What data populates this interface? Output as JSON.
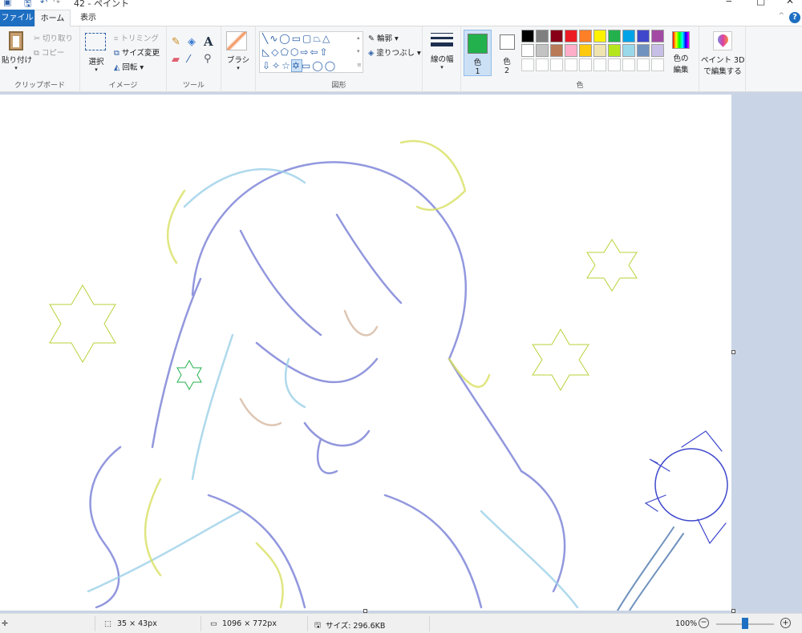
{
  "title": "42 - ペイント",
  "tabs": {
    "file": "ファイル",
    "home": "ホーム",
    "view": "表示"
  },
  "clipboard": {
    "paste": "貼り付け",
    "cut": "切り取り",
    "copy": "コピー",
    "label": "クリップボード"
  },
  "image": {
    "select": "選択",
    "crop": "トリミング",
    "resize": "サイズ変更",
    "rotate": "回転",
    "label": "イメージ"
  },
  "tools": {
    "label": "ツール"
  },
  "brush": {
    "label": "ブラシ"
  },
  "shapes": {
    "label": "図形",
    "outline": "輪郭",
    "fill": "塗りつぶし"
  },
  "size": {
    "label": "線の幅"
  },
  "colors": {
    "color1": "色",
    "color1_num": "1",
    "color2": "色",
    "color2_num": "2",
    "color1_value": "#22b14c",
    "color2_value": "#ffffff",
    "edit_line1": "色の",
    "edit_line2": "編集",
    "label": "色",
    "palette_row1": [
      "#000000",
      "#7f7f7f",
      "#880015",
      "#ed1c24",
      "#ff7f27",
      "#fff200",
      "#22b14c",
      "#00a2e8",
      "#3f48cc",
      "#a349a4"
    ],
    "palette_row2": [
      "#ffffff",
      "#c3c3c3",
      "#b97a57",
      "#ffaec9",
      "#ffc90e",
      "#efe4b0",
      "#b5e61d",
      "#99d9ea",
      "#7092be",
      "#c8bfe7"
    ]
  },
  "paint3d": {
    "line1": "ペイント 3D",
    "line2": "で編集する"
  },
  "status": {
    "selection": "35 × 43px",
    "image_size": "1096 × 772px",
    "file_size": "サイズ: 296.6KB",
    "zoom": "100%"
  }
}
